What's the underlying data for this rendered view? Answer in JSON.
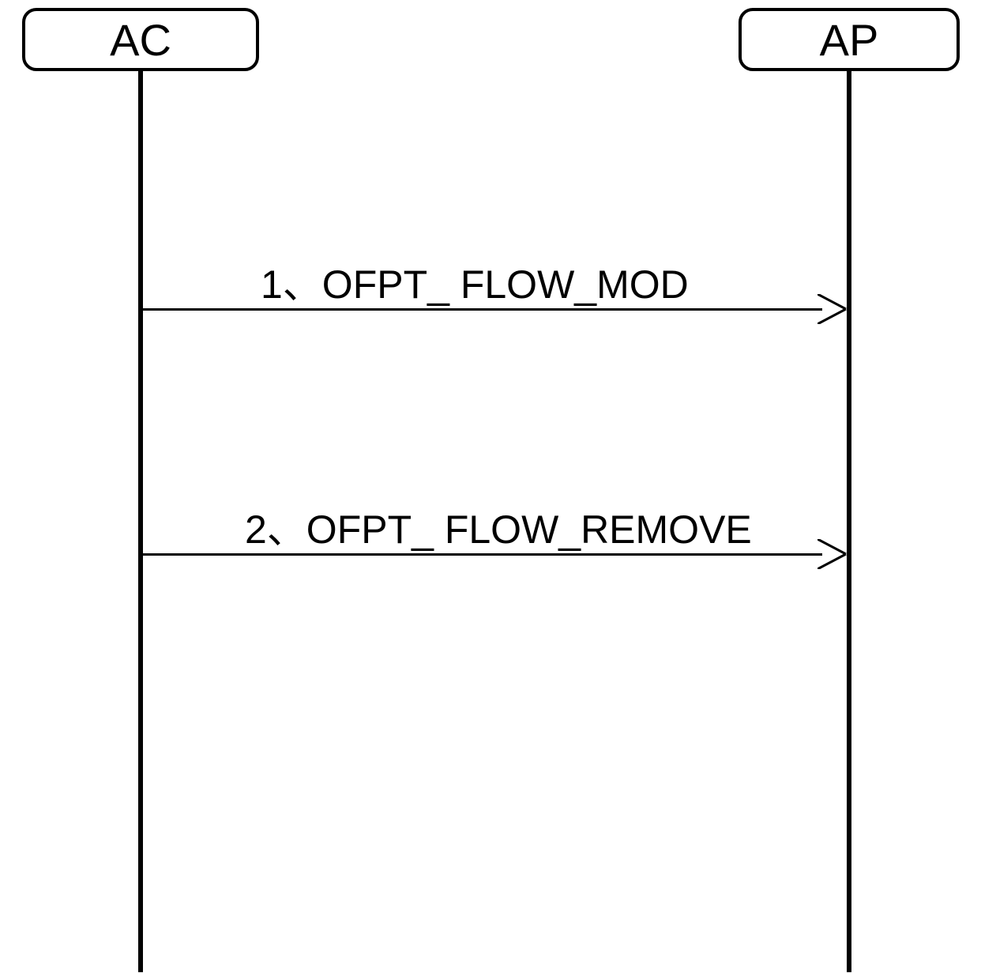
{
  "participants": {
    "left": {
      "label": "AC"
    },
    "right": {
      "label": "AP"
    }
  },
  "messages": {
    "msg1": {
      "label": "1、OFPT_ FLOW_MOD"
    },
    "msg2": {
      "label": "2、OFPT_ FLOW_REMOVE"
    }
  }
}
